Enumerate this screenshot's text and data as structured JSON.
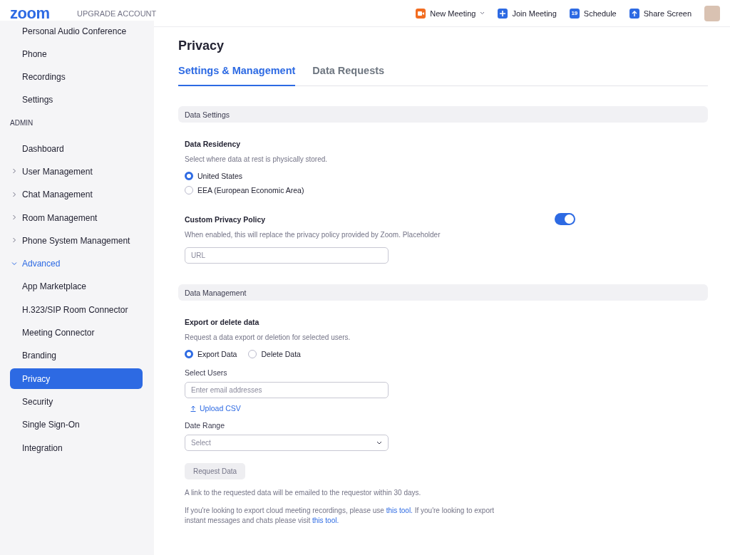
{
  "header": {
    "logo": "zoom",
    "upgrade": "UPGRADE ACCOUNT",
    "actions": [
      {
        "kind": "video",
        "label": "New Meeting",
        "dropdown": true
      },
      {
        "kind": "plus",
        "label": "Join Meeting",
        "dropdown": false
      },
      {
        "kind": "calendar",
        "label": "Schedule",
        "icon_text": "19",
        "dropdown": false
      },
      {
        "kind": "share",
        "label": "Share Screen",
        "dropdown": false
      }
    ]
  },
  "sidebar": {
    "items": [
      {
        "kind": "item",
        "label": "Personal Audio Conference",
        "selected": false
      },
      {
        "kind": "item",
        "label": "Phone",
        "selected": false
      },
      {
        "kind": "item",
        "label": "Recordings",
        "selected": false
      },
      {
        "kind": "item",
        "label": "Settings",
        "selected": false
      },
      {
        "kind": "heading",
        "label": "ADMIN"
      },
      {
        "kind": "item",
        "label": "Dashboard",
        "selected": false
      },
      {
        "kind": "group",
        "label": "User Management",
        "expanded": false
      },
      {
        "kind": "group",
        "label": "Chat Management",
        "expanded": false
      },
      {
        "kind": "group",
        "label": "Room Management",
        "expanded": false
      },
      {
        "kind": "group",
        "label": "Phone System Management",
        "expanded": false
      },
      {
        "kind": "group",
        "label": "Advanced",
        "expanded": true,
        "children": [
          {
            "kind": "item",
            "label": "App Marketplace",
            "selected": false
          },
          {
            "kind": "item",
            "label": "H.323/SIP Room Connector",
            "selected": false
          },
          {
            "kind": "item",
            "label": "Meeting Connector",
            "selected": false
          },
          {
            "kind": "item",
            "label": "Branding",
            "selected": false
          },
          {
            "kind": "item",
            "label": "Privacy",
            "selected": true
          },
          {
            "kind": "item",
            "label": "Security",
            "selected": false
          },
          {
            "kind": "item",
            "label": "Single Sign-On",
            "selected": false
          },
          {
            "kind": "item",
            "label": "Integration",
            "selected": false
          }
        ]
      }
    ]
  },
  "page": {
    "title": "Privacy",
    "tabs": [
      {
        "label": "Settings & Management",
        "selected": true
      },
      {
        "label": "Data Requests",
        "selected": false
      }
    ],
    "data_settings": {
      "heading": "Data Settings",
      "residency": {
        "title": "Data Residency",
        "description": "Select where data at rest is physically stored.",
        "options": [
          {
            "label": "United States",
            "selected": true
          },
          {
            "label": "EEA (European Economic Area)",
            "selected": false
          }
        ]
      },
      "policy": {
        "title": "Custom Privacy Policy",
        "on": true,
        "description": "When enabled, this will replace the privacy policy provided by Zoom. Placeholder",
        "placeholder": "URL"
      }
    },
    "data_management": {
      "heading": "Data Management",
      "title": "Export or delete data",
      "description": "Request a data export or deletion for selected users.",
      "options": [
        {
          "label": "Export Data",
          "selected": true
        },
        {
          "label": "Delete Data",
          "selected": false
        }
      ],
      "users_label": "Select Users",
      "users_placeholder": "Enter email addresses",
      "upload": "Upload CSV",
      "date_label": "Date Range",
      "date_placeholder": "Select",
      "button": "Request Data",
      "note": "A link to the requested data will be emailed to the requestor within 30 days.",
      "footer": [
        {
          "text": "If you're looking to export cloud meeting recordings, please use ",
          "link": false
        },
        {
          "text": "this tool.",
          "link": true
        },
        {
          "text": " If you're looking to export instant messages and chats please visit ",
          "link": false
        },
        {
          "text": "this tool.",
          "link": true
        }
      ]
    }
  }
}
